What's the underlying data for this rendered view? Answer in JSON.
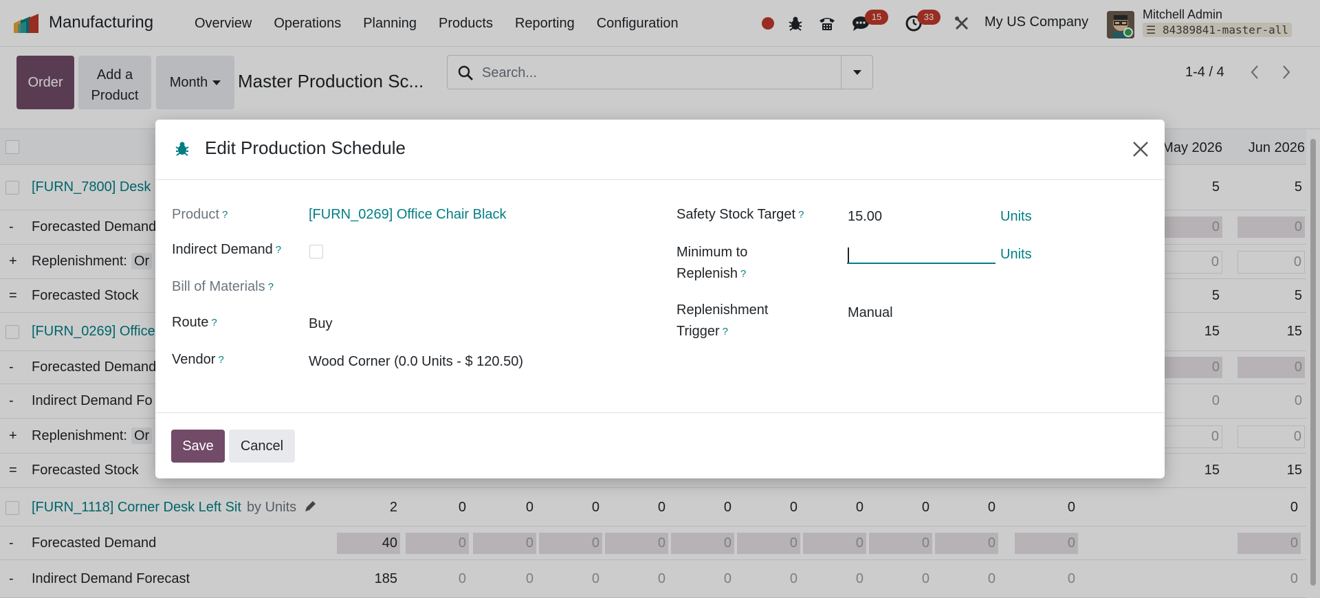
{
  "navbar": {
    "app_name": "Manufacturing",
    "menu": [
      "Overview",
      "Operations",
      "Planning",
      "Products",
      "Reporting",
      "Configuration"
    ],
    "messages_badge": "15",
    "activities_badge": "33",
    "company": "My US Company",
    "user_name": "Mitchell Admin",
    "database": "84389841-master-all"
  },
  "control_panel": {
    "order_button": "Order",
    "add_product_line1": "Add a",
    "add_product_line2": "Product",
    "period_button": "Month",
    "breadcrumb": "Master Production Sc...",
    "search_placeholder": "Search...",
    "pager": "1-4 / 4"
  },
  "table": {
    "headers": [
      "May 2026",
      "Jun 2026"
    ],
    "rows": [
      {
        "sign": "",
        "label": "[FURN_7800] Desk",
        "kind": "product",
        "values": [
          "5",
          "5"
        ]
      },
      {
        "sign": "-",
        "label": "Forecasted Demand",
        "kind": "shaded",
        "values": [
          "0",
          "0"
        ]
      },
      {
        "sign": "+",
        "label": "Replenishment:",
        "tag": "Or",
        "kind": "boxed",
        "values": [
          "0",
          "0"
        ]
      },
      {
        "sign": "=",
        "label": "Forecasted Stock",
        "kind": "dark",
        "values": [
          "5",
          "5"
        ]
      },
      {
        "sign": "",
        "label": "[FURN_0269] Office",
        "kind": "product",
        "values": [
          "15",
          "15"
        ]
      },
      {
        "sign": "-",
        "label": "Forecasted Demand",
        "kind": "shaded",
        "values": [
          "0",
          "0"
        ]
      },
      {
        "sign": "-",
        "label": "Indirect Demand Fo",
        "kind": "plain",
        "values": [
          "0",
          "0"
        ]
      },
      {
        "sign": "+",
        "label": "Replenishment:",
        "tag": "Or",
        "kind": "boxed",
        "values": [
          "0",
          "0"
        ]
      },
      {
        "sign": "=",
        "label": "Forecasted Stock",
        "kind": "dark",
        "values": [
          "15",
          "15"
        ]
      }
    ],
    "full_rows": [
      {
        "sign": "",
        "label": "[FURN_1118] Corner Desk Left Sit",
        "suffix": "by Units",
        "kind": "product",
        "values": [
          "2",
          "0",
          "0",
          "0",
          "0",
          "0",
          "0",
          "0",
          "0",
          "0",
          "0",
          "0"
        ]
      },
      {
        "sign": "-",
        "label": "Forecasted Demand",
        "kind": "shaded",
        "values": [
          "40",
          "0",
          "0",
          "0",
          "0",
          "0",
          "0",
          "0",
          "0",
          "0",
          "0",
          "0"
        ]
      },
      {
        "sign": "-",
        "label": "Indirect Demand Forecast",
        "kind": "plain",
        "values": [
          "185",
          "0",
          "0",
          "0",
          "0",
          "0",
          "0",
          "0",
          "0",
          "0",
          "0",
          "0"
        ]
      }
    ]
  },
  "modal": {
    "title": "Edit Production Schedule",
    "product_label": "Product",
    "product_value": "[FURN_0269] Office Chair Black",
    "indirect_label": "Indirect Demand",
    "indirect_checked": false,
    "bom_label": "Bill of Materials",
    "route_label": "Route",
    "route_value": "Buy",
    "vendor_label": "Vendor",
    "vendor_value": "Wood Corner (0.0 Units - $ 120.50)",
    "safety_label": "Safety Stock Target",
    "safety_value": "15.00",
    "safety_uom": "Units",
    "min_label_line1": "Minimum to",
    "min_label_line2": "Replenish",
    "min_value": "",
    "min_uom": "Units",
    "trigger_label_line1": "Replenishment",
    "trigger_label_line2": "Trigger",
    "trigger_value": "Manual",
    "help_mark": "?",
    "save_label": "Save",
    "cancel_label": "Cancel"
  },
  "colors": {
    "brand": "#714b67",
    "link": "#017e84",
    "badge": "#c0392b"
  }
}
